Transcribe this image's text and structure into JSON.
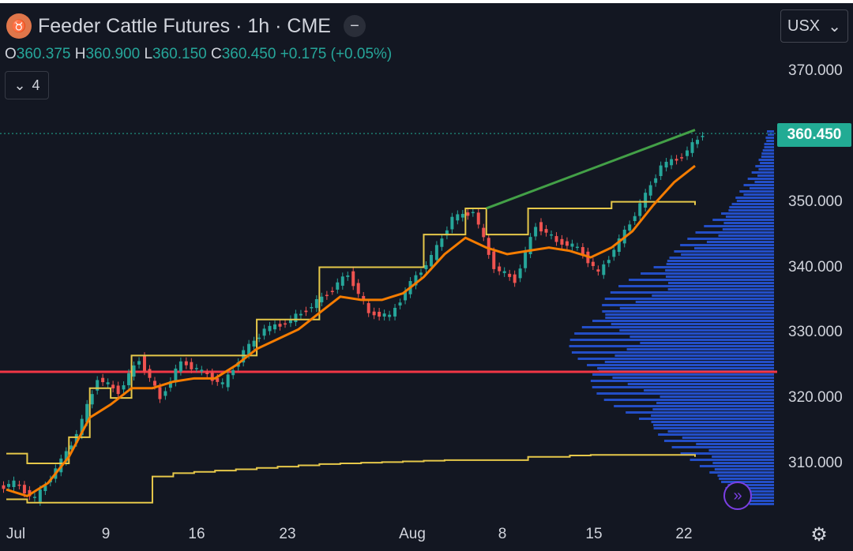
{
  "header": {
    "logo_glyph": "♉",
    "title": "Feeder Cattle Futures · 1h · CME",
    "dash_glyph": "−"
  },
  "ohlc": {
    "o_label": "O",
    "o": "360.375",
    "h_label": "H",
    "h": "360.900",
    "l_label": "L",
    "l": "360.150",
    "c_label": "C",
    "c": "360.450",
    "change": "+0.175 (+0.05%)"
  },
  "indicators_toggle": {
    "chevron": "⌄",
    "count": "4"
  },
  "currency_select": {
    "value": "USX",
    "chevron": "⌄"
  },
  "last_price_label": "360.450",
  "y_ticks": [
    "370.000",
    "350.000",
    "340.000",
    "330.000",
    "320.000",
    "310.000"
  ],
  "x_ticks": [
    "Jul",
    "9",
    "16",
    "23",
    "Aug",
    "8",
    "15",
    "22"
  ],
  "colors": {
    "up": "#26a69a",
    "down": "#ef5350",
    "ema": "#f57c00",
    "vwap": "#e6c84a",
    "trendline": "#43a047",
    "support": "#f23645",
    "profile": "#2962ff",
    "last_price": "#22ab94"
  },
  "chart_data": {
    "type": "line",
    "x": [
      "Jul 2",
      "Jul 3",
      "Jul 5",
      "Jul 8",
      "Jul 10",
      "Jul 11",
      "Jul 12",
      "Jul 15",
      "Jul 17",
      "Jul 18",
      "Jul 19",
      "Jul 22",
      "Jul 24",
      "Jul 25",
      "Jul 26",
      "Jul 29",
      "Jul 30",
      "Jul 31",
      "Aug 1",
      "Aug 2",
      "Aug 5",
      "Aug 6",
      "Aug 7",
      "Aug 8",
      "Aug 9",
      "Aug 12",
      "Aug 13",
      "Aug 14",
      "Aug 15",
      "Aug 16",
      "Aug 19",
      "Aug 20",
      "Aug 21",
      "Aug 22"
    ],
    "series": [
      {
        "values": [
          307.0,
          304.5,
          309.0,
          314.5,
          323.0,
          321.0,
          326.0,
          320.0,
          325.5,
          324.0,
          322.0,
          327.0,
          330.5,
          331.5,
          333.5,
          336.0,
          339.0,
          333.0,
          332.5,
          337.5,
          341.5,
          347.5,
          348.5,
          340.0,
          338.0,
          346.5,
          344.0,
          343.0,
          339.0,
          344.0,
          349.5,
          355.5,
          357.0,
          360.45
        ]
      },
      {
        "values": [
          306.0,
          305.0,
          307.0,
          311.0,
          317.0,
          319.0,
          321.5,
          321.5,
          322.5,
          323.0,
          323.0,
          325.0,
          327.5,
          329.0,
          330.5,
          333.0,
          335.5,
          335.0,
          335.0,
          336.0,
          338.5,
          342.0,
          344.5,
          343.0,
          342.0,
          342.5,
          343.0,
          342.5,
          341.5,
          343.0,
          345.5,
          349.5,
          353.0,
          355.5
        ]
      },
      {
        "values": [
          311.5,
          310.0,
          310.0,
          314.0,
          321.5,
          320.0,
          326.5,
          326.5,
          326.5,
          326.5,
          326.5,
          326.5,
          332.0,
          332.0,
          332.0,
          340.0,
          340.0,
          340.0,
          340.0,
          340.0,
          345.0,
          345.0,
          349.0,
          345.0,
          345.0,
          349.0,
          349.0,
          349.0,
          349.0,
          350.0,
          350.0,
          350.0,
          350.0,
          349.5
        ]
      },
      {
        "values": [
          304.5,
          304.0,
          304.0,
          304.0,
          304.0,
          304.0,
          304.0,
          308.0,
          308.5,
          308.7,
          308.9,
          309.1,
          309.3,
          309.5,
          309.7,
          309.9,
          310.0,
          310.1,
          310.2,
          310.3,
          310.4,
          310.5,
          310.5,
          310.5,
          310.5,
          311.0,
          311.0,
          311.2,
          311.3,
          311.3,
          311.3,
          311.3,
          311.3,
          311.0
        ]
      }
    ],
    "trendline": {
      "x": [
        "Aug 8",
        "Aug 22"
      ],
      "y": [
        349.0,
        361.0
      ]
    },
    "horizontal_line": 324.0,
    "last_price": 360.45,
    "ylim": [
      304,
      372
    ],
    "y_ticks": [
      370,
      350,
      340,
      330,
      320,
      310
    ],
    "x_ticks": [
      "Jul",
      "9",
      "16",
      "23",
      "Aug",
      "8",
      "15",
      "22"
    ],
    "grid": false,
    "legend": "none"
  }
}
